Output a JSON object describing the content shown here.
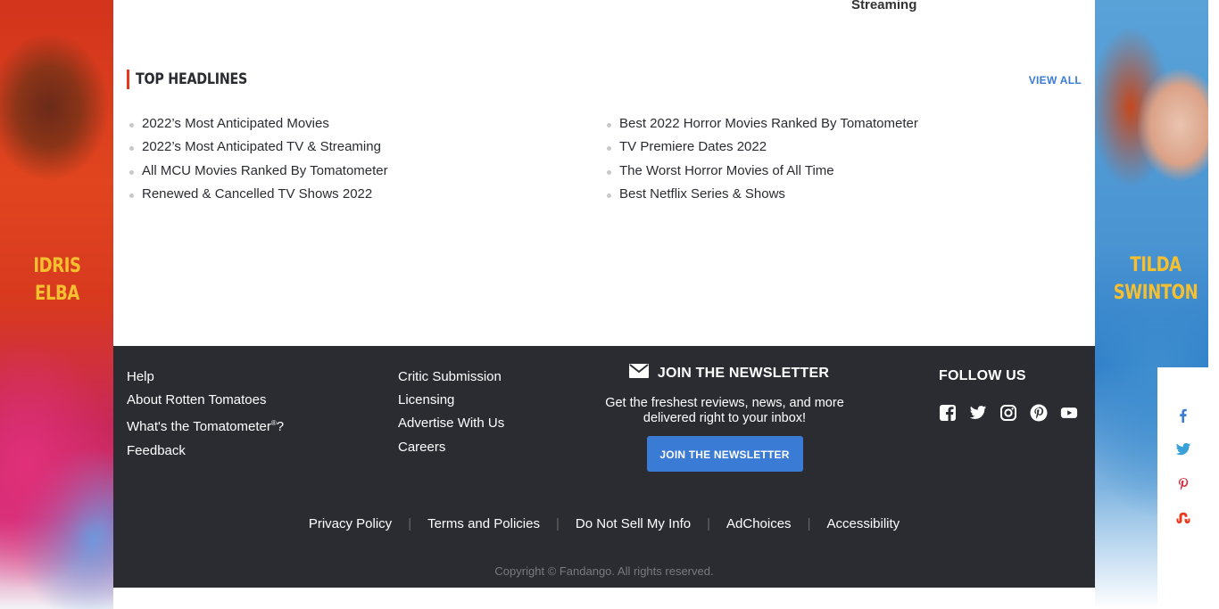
{
  "top_fragment": {
    "streaming": "Streaming"
  },
  "ads": {
    "left_actor": [
      "IDRIS",
      "ELBA"
    ],
    "right_actor": [
      "TILDA",
      "SWINTON"
    ]
  },
  "headlines": {
    "title": "Top Headlines",
    "view_all": "VIEW ALL",
    "left": [
      "2022’s Most Anticipated Movies",
      "2022’s Most Anticipated TV & Streaming",
      "All MCU Movies Ranked By Tomatometer",
      "Renewed & Cancelled TV Shows 2022"
    ],
    "right": [
      "Best 2022 Horror Movies Ranked By Tomatometer",
      "TV Premiere Dates 2022",
      "The Worst Horror Movies of All Time",
      "Best Netflix Series & Shows"
    ]
  },
  "footer": {
    "col1": [
      "Help",
      "About Rotten Tomatoes",
      "What's the Tomatometer",
      "Feedback"
    ],
    "tomatometer_suffix": "?",
    "registered_mark": "®",
    "col2": [
      "Critic Submission",
      "Licensing",
      "Advertise With Us",
      "Careers"
    ],
    "newsletter": {
      "title": "JOIN THE NEWSLETTER",
      "description": "Get the freshest reviews, news, and more delivered right to your inbox!",
      "button": "JOIN THE NEWSLETTER",
      "icon": "envelope-icon"
    },
    "follow": {
      "title": "FOLLOW US",
      "icons": [
        "facebook-icon",
        "twitter-icon",
        "instagram-icon",
        "pinterest-icon",
        "youtube-icon"
      ]
    },
    "legal": [
      "Privacy Policy",
      "Terms and Policies",
      "Do Not Sell My Info",
      "AdChoices",
      "Accessibility"
    ],
    "legal_separator": "|",
    "copyright": "Copyright © Fandango. All rights reserved."
  },
  "share_bar": {
    "icons": [
      "facebook-icon",
      "twitter-icon",
      "pinterest-icon",
      "stumbleupon-icon"
    ]
  },
  "colors": {
    "accent": "#e8381b",
    "link_blue": "#3a7bd5",
    "footer_bg": "#2a2c32",
    "actor_name": "#f5c030"
  }
}
